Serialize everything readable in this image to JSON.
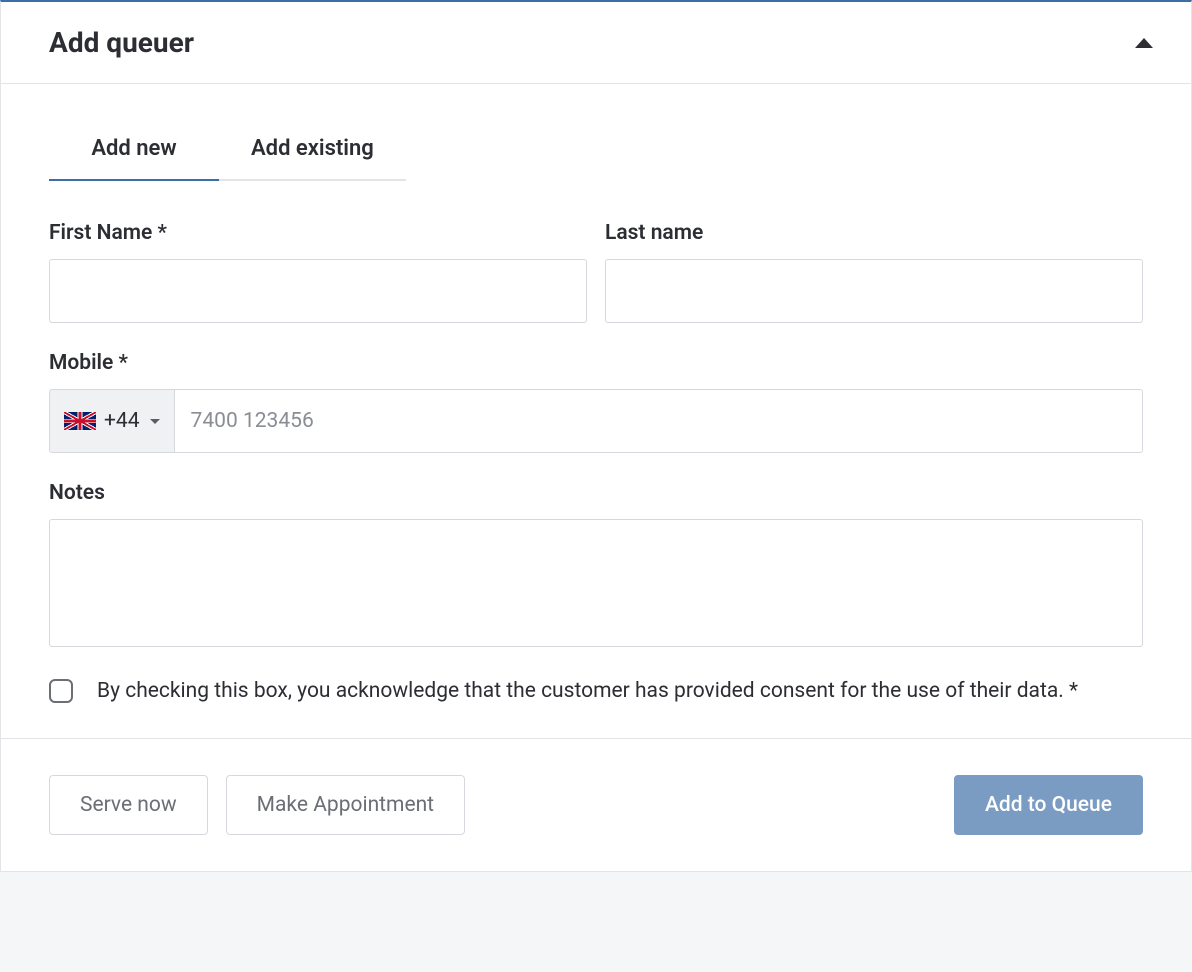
{
  "panel": {
    "title": "Add queuer"
  },
  "tabs": {
    "add_new": "Add new",
    "add_existing": "Add existing"
  },
  "form": {
    "first_name_label": "First Name *",
    "first_name_value": "",
    "last_name_label": "Last name",
    "last_name_value": "",
    "mobile_label": "Mobile *",
    "mobile_dial_code": "+44",
    "mobile_placeholder": "7400 123456",
    "mobile_value": "",
    "notes_label": "Notes",
    "notes_value": "",
    "consent_text": "By checking this box, you acknowledge that the customer has provided consent for the use of their data. *"
  },
  "footer": {
    "serve_now": "Serve now",
    "make_appointment": "Make Appointment",
    "add_to_queue": "Add to Queue"
  }
}
